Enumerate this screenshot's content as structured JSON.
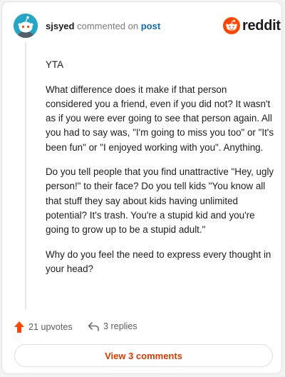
{
  "header": {
    "username": "sjsyed",
    "action_text": "commented on",
    "post_link": "post",
    "brand": "reddit"
  },
  "comment": {
    "paragraphs": [
      "YTA",
      "What difference does it make if that person considered you a friend, even if you did not? It wasn't as if you were ever going to see that person again. All you had to say was, \"I'm going to miss you too\" or \"It's been fun\" or \"I enjoyed working with you\". Anything.",
      "Do you tell people that you find unattractive \"Hey, ugly person!\" to their face? Do you tell kids \"You know all that stuff they say about kids having unlimited potential? It's trash. You're a stupid kid and you're going to grow up to be a stupid adult.\"",
      "Why do you feel the need to express every thought in your head?"
    ]
  },
  "footer": {
    "upvotes_label": "21 upvotes",
    "replies_label": "3 replies",
    "view_comments_label": "View 3 comments"
  },
  "colors": {
    "upvote_accent": "#ff4500",
    "link": "#0e6bb4",
    "view_comments_text": "#d93a00",
    "avatar_bg": "#24a6c7"
  },
  "icons": {
    "avatar": "snoo-avatar-icon",
    "logo": "reddit-snoo-icon",
    "upvote": "upvote-arrow-icon",
    "reply": "reply-arrow-icon"
  }
}
